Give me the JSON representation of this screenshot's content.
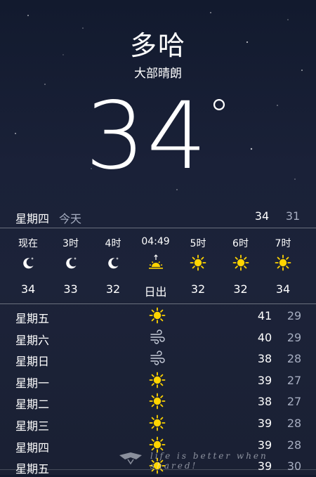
{
  "location": {
    "city": "多哈",
    "condition": "大部晴朗"
  },
  "current": {
    "temperature": "34",
    "degree": "°"
  },
  "today": {
    "day": "星期四",
    "label": "今天",
    "high": "34",
    "low": "31"
  },
  "hourly": [
    {
      "time": "现在",
      "icon": "moon-icon",
      "value": "34"
    },
    {
      "time": "3时",
      "icon": "moon-icon",
      "value": "33"
    },
    {
      "time": "4时",
      "icon": "moon-icon",
      "value": "32"
    },
    {
      "time": "04:49",
      "icon": "sunrise-icon",
      "value": "日出"
    },
    {
      "time": "5时",
      "icon": "sun-icon",
      "value": "32"
    },
    {
      "time": "6时",
      "icon": "sun-icon",
      "value": "32"
    },
    {
      "time": "7时",
      "icon": "sun-icon",
      "value": "34"
    }
  ],
  "daily": [
    {
      "day": "星期五",
      "icon": "sun-icon",
      "high": "41",
      "low": "29"
    },
    {
      "day": "星期六",
      "icon": "wind-icon",
      "high": "40",
      "low": "29"
    },
    {
      "day": "星期日",
      "icon": "wind-icon",
      "high": "38",
      "low": "28"
    },
    {
      "day": "星期一",
      "icon": "sun-icon",
      "high": "39",
      "low": "27"
    },
    {
      "day": "星期二",
      "icon": "sun-icon",
      "high": "38",
      "low": "27"
    },
    {
      "day": "星期三",
      "icon": "sun-icon",
      "high": "39",
      "low": "28"
    },
    {
      "day": "星期四",
      "icon": "sun-icon",
      "high": "39",
      "low": "28"
    },
    {
      "day": "星期五",
      "icon": "sun-icon",
      "high": "39",
      "low": "30"
    }
  ],
  "watermark": {
    "text": "life is better when shared!"
  },
  "colors": {
    "sun": "#ffd400",
    "secondary_text": "#a6adc0",
    "background": "#1a2138"
  }
}
